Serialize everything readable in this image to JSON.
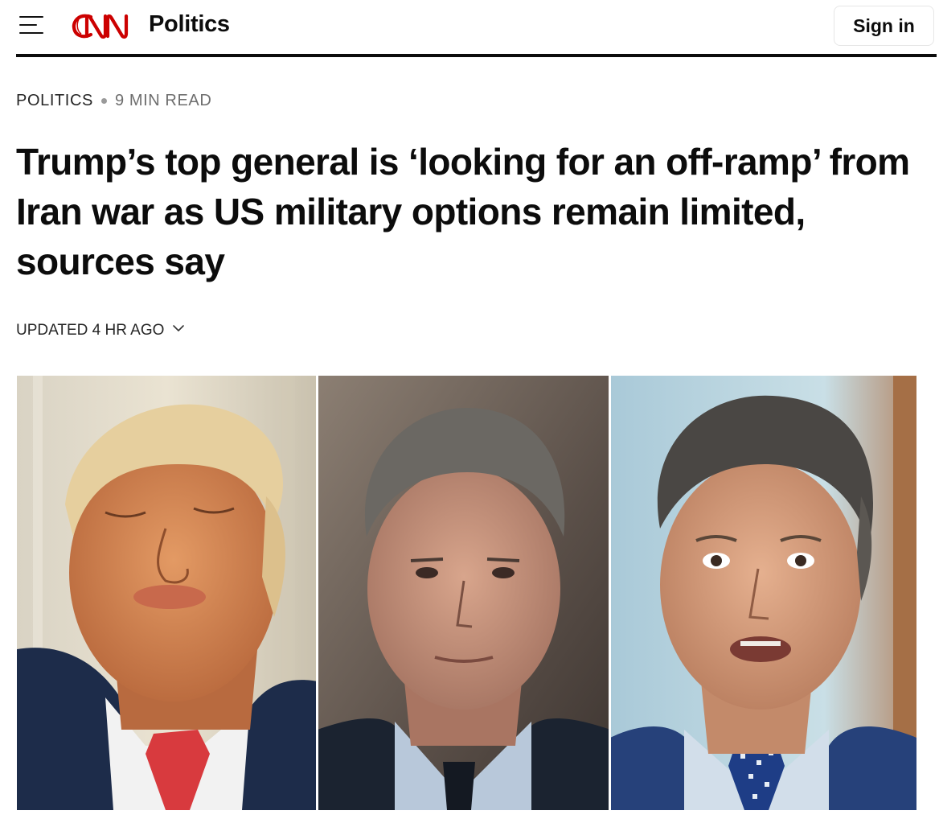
{
  "header": {
    "menu_icon": "hamburger-menu-icon",
    "logo_text": "CNN",
    "section_title": "Politics",
    "signin_label": "Sign in"
  },
  "article": {
    "section": "POLITICS",
    "read_time": "9 MIN READ",
    "headline": "Trump’s top general is ‘looking for an off-ramp’ from Iran war as US military options remain limited, sources say",
    "updated": "UPDATED 4 HR AGO",
    "updated_icon": "chevron-down-icon"
  },
  "hero_image": {
    "panels": 3
  },
  "colors": {
    "brand_red": "#cc0000",
    "text": "#0c0c0c",
    "muted": "#6e6e6e"
  }
}
